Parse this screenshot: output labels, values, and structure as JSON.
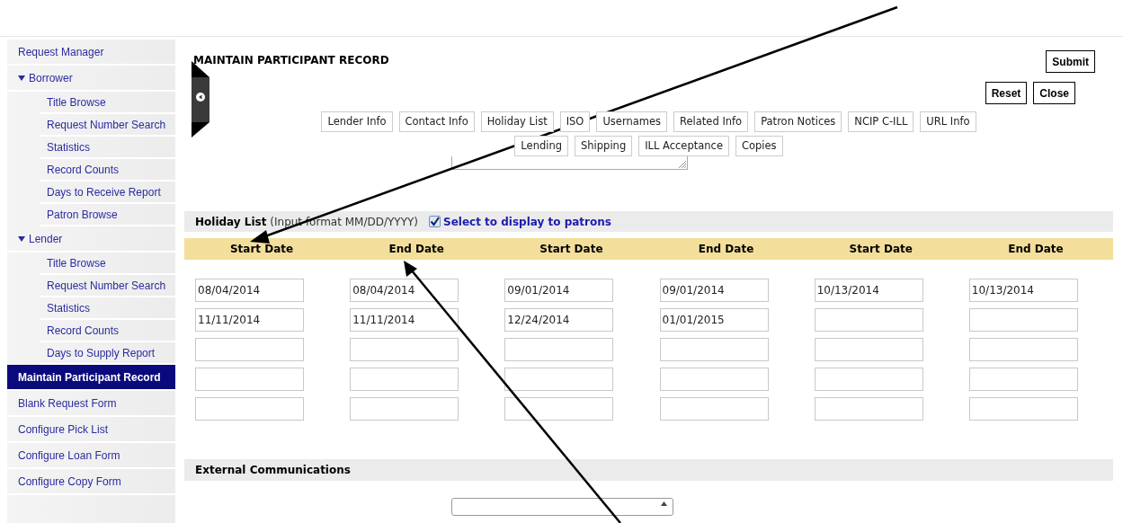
{
  "sidebar": {
    "items": [
      {
        "kind": "link",
        "label": "Request Manager",
        "selected": false
      },
      {
        "kind": "group",
        "label": "Borrower",
        "expanded": true,
        "selected": false,
        "children": [
          {
            "label": "Title Browse",
            "selected": false
          },
          {
            "label": "Request Number Search",
            "selected": false
          },
          {
            "label": "Statistics",
            "selected": false
          },
          {
            "label": "Record Counts",
            "selected": false
          },
          {
            "label": "Days to Receive Report",
            "selected": false
          },
          {
            "label": "Patron Browse",
            "selected": false
          }
        ]
      },
      {
        "kind": "group",
        "label": "Lender",
        "expanded": true,
        "selected": false,
        "children": [
          {
            "label": "Title Browse",
            "selected": false
          },
          {
            "label": "Request Number Search",
            "selected": false
          },
          {
            "label": "Statistics",
            "selected": false
          },
          {
            "label": "Record Counts",
            "selected": false
          },
          {
            "label": "Days to Supply Report",
            "selected": false
          }
        ]
      },
      {
        "kind": "link",
        "label": "Maintain Participant Record",
        "selected": true
      },
      {
        "kind": "link",
        "label": "Blank Request Form",
        "selected": false
      },
      {
        "kind": "link",
        "label": "Configure Pick List",
        "selected": false
      },
      {
        "kind": "link",
        "label": "Configure Loan Form",
        "selected": false
      },
      {
        "kind": "link",
        "label": "Configure Copy Form",
        "selected": false
      }
    ]
  },
  "page": {
    "title": "MAINTAIN PARTICIPANT RECORD",
    "submit": "Submit",
    "reset": "Reset",
    "close": "Close"
  },
  "tab_rows": [
    [
      "Lender Info",
      "Contact Info",
      "Holiday List",
      "ISO",
      "Usernames",
      "Related Info",
      "Patron Notices",
      "NCIP C-ILL",
      "URL Info"
    ],
    [
      "Lending",
      "Shipping",
      "ILL Acceptance",
      "Copies"
    ]
  ],
  "holiday_list": {
    "title": "Holiday List",
    "note": "(Input format MM/DD/YYYY)",
    "display_checkbox": {
      "label": "Select to display to patrons",
      "checked": true
    },
    "columns": [
      "Start Date",
      "End Date",
      "Start Date",
      "End Date",
      "Start Date",
      "End Date"
    ],
    "rows": [
      [
        {
          "value": "08/04/2014"
        },
        {
          "value": "08/04/2014"
        },
        {
          "value": "09/01/2014"
        },
        {
          "value": "09/01/2014"
        },
        {
          "value": "10/13/2014"
        },
        {
          "value": "10/13/2014"
        }
      ],
      [
        {
          "value": "11/11/2014"
        },
        {
          "value": "11/11/2014"
        },
        {
          "value": "12/24/2014"
        },
        {
          "value": "01/01/2015"
        },
        {},
        {}
      ],
      [
        {},
        {},
        {},
        {},
        {},
        {}
      ],
      [
        {},
        {},
        {},
        {},
        {},
        {}
      ],
      [
        {},
        {},
        {},
        {},
        {},
        {}
      ]
    ]
  },
  "external_communications": {
    "title": "External Communications"
  }
}
